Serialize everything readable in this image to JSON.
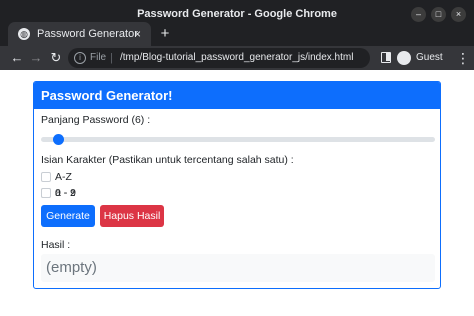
{
  "window": {
    "title": "Password Generator - Google Chrome",
    "controls": {
      "minimize": "–",
      "maximize": "□",
      "close": "×"
    }
  },
  "tab": {
    "favicon": "globe-icon",
    "title": "Password Generator",
    "close": "×"
  },
  "tabstrip": {
    "new_tab": "+"
  },
  "toolbar": {
    "back": "←",
    "forward": "→",
    "reload": "↻",
    "info": "i",
    "url_scheme": "File",
    "url_separator": "|",
    "url_path": "/tmp/Blog-tutorial_password_generator_js/index.html",
    "profile_label": "Guest",
    "menu": "⋮"
  },
  "page": {
    "header": "Password Generator!",
    "length_label": "Panjang Password (6) :",
    "length_value": 6,
    "charset_label": "Isian Karakter (Pastikan untuk tercentang salah satu) :",
    "options": [
      {
        "label": "A-Z",
        "checked": false
      },
      {
        "label": "a - z",
        "checked": false
      },
      {
        "label": "0 - 9",
        "checked": false
      }
    ],
    "generate_button": "Generate",
    "clear_button": "Hapus Hasil",
    "result_label": "Hasil :",
    "result_value": "(empty)"
  },
  "colors": {
    "primary": "#0d6efd",
    "danger": "#dc3545",
    "chrome_dark": "#202124",
    "chrome_toolbar": "#35363a"
  }
}
